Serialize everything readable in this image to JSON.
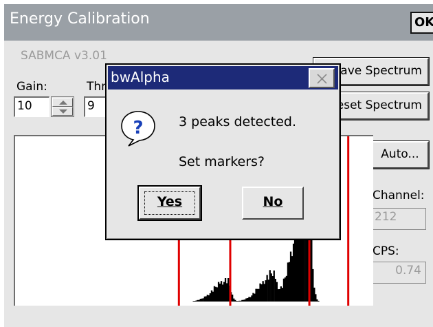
{
  "window": {
    "title": "Energy Calibration",
    "ok_label": "OK"
  },
  "app": {
    "version_label": "SABMCA v3.01",
    "gain_label": "Gain:",
    "gain_value": "10",
    "threshold_label": "Threshold:",
    "threshold_value": "9",
    "save_spectrum_label": "Save Spectrum",
    "reset_spectrum_label": "Reset Spectrum",
    "auto_label": "Auto...",
    "channel_label": "Channel:",
    "channel_value": "212",
    "cps_label": "CPS:",
    "cps_value": "0.74"
  },
  "dialog": {
    "title": "bwAlpha",
    "message": "3 peaks detected.",
    "question": "Set markers?",
    "yes_label": "Yes",
    "no_label": "No"
  },
  "spectrum": {
    "marker_color": "#e00000",
    "marker_channels": [
      118,
      155,
      212,
      240
    ],
    "peaks": [
      {
        "channel": 152,
        "height": 0.14
      },
      {
        "channel": 185,
        "height": 0.17
      },
      {
        "channel": 210,
        "height": 0.75
      }
    ]
  },
  "colors": {
    "titlebar": "#9aa0a6",
    "dialog_titlebar": "#1d2a78",
    "surface": "#e6e6e6"
  }
}
